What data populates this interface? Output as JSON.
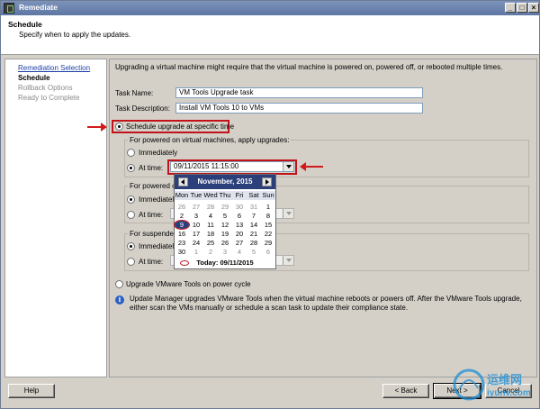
{
  "window": {
    "title": "Remediate"
  },
  "header": {
    "title": "Schedule",
    "subtitle": "Specify when to apply the updates."
  },
  "sidebar": {
    "items": [
      {
        "label": "Remediation Selection",
        "state": "link"
      },
      {
        "label": "Schedule",
        "state": "current"
      },
      {
        "label": "Rollback Options",
        "state": "disabled"
      },
      {
        "label": "Ready to Complete",
        "state": "disabled"
      }
    ]
  },
  "main": {
    "intro": "Upgrading a virtual machine might require that the virtual machine is powered on, powered off, or rebooted multiple times.",
    "task_name_label": "Task Name:",
    "task_name_value": "VM Tools Upgrade task",
    "task_desc_label": "Task Description:",
    "task_desc_value": "Install VM Tools 10 to VMs",
    "schedule_specific_label": "Schedule upgrade at specific time",
    "powered_on_group": "For powered on virtual machines, apply upgrades:",
    "immediately_label": "Immediately",
    "at_time_label": "At time:",
    "at_time_value": "09/11/2015 11:15:00",
    "powered_off_group_partial": "For powered o",
    "immediately_partial": "Immediately",
    "suspended_group_partial": "For suspended",
    "upgrade_power_cycle_label": "Upgrade VMware Tools on power cycle",
    "info_text_1": "Update Manager upgrades VMware Tools when the virtual machine reboots or powers off. After the VMware Tools upgrade,",
    "info_text_2": "either scan the VMs manually or schedule a scan task to update their compliance state."
  },
  "calendar": {
    "month": "November, 2015",
    "days": [
      "Mon",
      "Tue",
      "Wed",
      "Thu",
      "Fri",
      "Sat",
      "Sun"
    ],
    "weeks": [
      [
        "26",
        "27",
        "28",
        "29",
        "30",
        "31",
        "1"
      ],
      [
        "2",
        "3",
        "4",
        "5",
        "6",
        "7",
        "8"
      ],
      [
        "9",
        "10",
        "11",
        "12",
        "13",
        "14",
        "15"
      ],
      [
        "16",
        "17",
        "18",
        "19",
        "20",
        "21",
        "22"
      ],
      [
        "23",
        "24",
        "25",
        "26",
        "27",
        "28",
        "29"
      ],
      [
        "30",
        "1",
        "2",
        "3",
        "4",
        "5",
        "6"
      ]
    ],
    "selected": "9",
    "today": "Today: 09/11/2015"
  },
  "footer": {
    "help": "Help",
    "back": "< Back",
    "next": "Next >",
    "cancel": "Cancel"
  },
  "watermark": {
    "cn": "运维网",
    "en": "iyunv.com"
  },
  "colors": {
    "title_bar": "#5d76a3",
    "accent_red": "#c1121a",
    "calendar_header": "#2b3f7a",
    "link": "#1d3fa6"
  },
  "icons": [
    "app-icon",
    "minimize-icon",
    "maximize-icon",
    "close-icon",
    "info-icon",
    "dropdown-arrow-icon",
    "calendar-prev-icon",
    "calendar-next-icon"
  ]
}
